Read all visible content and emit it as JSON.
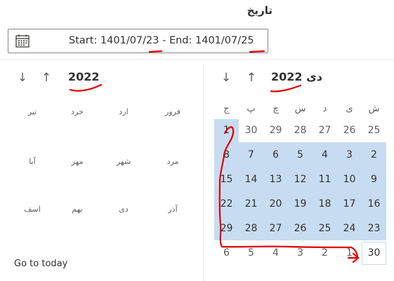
{
  "title": "تاریخ",
  "date_field": {
    "value": "Start: 1401/07/23 - End: 1401/07/25",
    "icon": "calendar-icon"
  },
  "month_picker": {
    "year": "2022",
    "prev_label": "↓",
    "next_label": "↑",
    "months": [
      "فرور",
      "ارد",
      "خرد",
      "تیر",
      "مرد",
      "شهر",
      "مهر",
      "آبا",
      "آذر",
      "دی",
      "بهم",
      "اسف"
    ],
    "go_to_today": "Go to today"
  },
  "day_picker": {
    "header": "دی 2022",
    "prev_label": "↓",
    "next_label": "↑",
    "weekdays": [
      "ش",
      "ی",
      "د",
      "س",
      "چ",
      "پ",
      "ج"
    ],
    "weeks": [
      [
        "25",
        "26",
        "27",
        "28",
        "29",
        "30",
        "1"
      ],
      [
        "2",
        "3",
        "4",
        "5",
        "6",
        "7",
        "8"
      ],
      [
        "9",
        "10",
        "11",
        "12",
        "13",
        "14",
        "15"
      ],
      [
        "16",
        "17",
        "18",
        "19",
        "20",
        "21",
        "22"
      ],
      [
        "23",
        "24",
        "25",
        "26",
        "27",
        "28",
        "29"
      ],
      [
        "30",
        "1",
        "2",
        "3",
        "4",
        "5",
        "6"
      ]
    ]
  },
  "colors": {
    "selection": "#c7dcf1",
    "annotation": "#e00000",
    "text": "#323130",
    "muted": "#605e5c"
  }
}
